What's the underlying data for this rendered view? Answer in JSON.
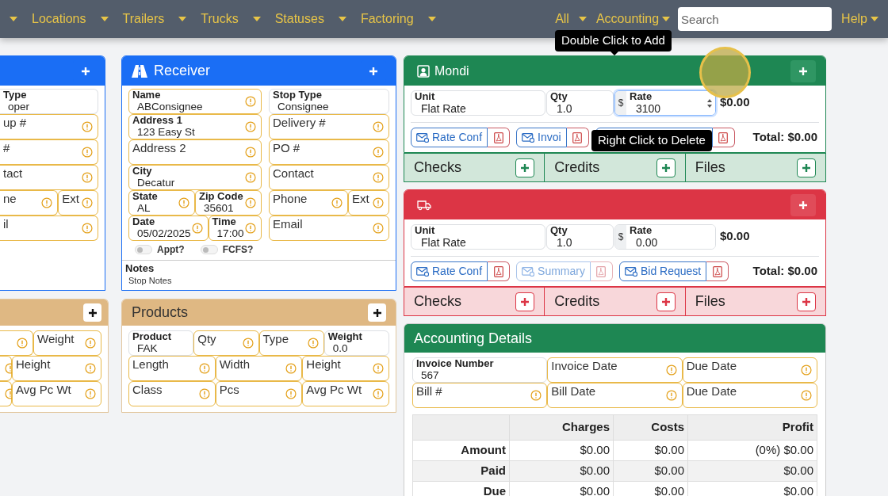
{
  "navbar": {
    "menus": [
      {
        "label": "Locations"
      },
      {
        "label": "Trailers"
      },
      {
        "label": "Trucks"
      },
      {
        "label": "Statuses"
      },
      {
        "label": "Factoring"
      }
    ],
    "right_menus": [
      {
        "label": "All"
      },
      {
        "label": "Accounting"
      }
    ],
    "search": {
      "placeholder": "Search"
    },
    "help": {
      "label": "Help"
    }
  },
  "shipper_partial": {
    "rows": [
      [
        {
          "label": "Type",
          "value": "oper",
          "warning": false
        }
      ],
      [
        {
          "label": "up #",
          "warning": true
        }
      ],
      [
        {
          "label": "#",
          "warning": true
        }
      ],
      [
        {
          "label": "tact",
          "warning": true
        }
      ],
      [
        {
          "label": "ne",
          "warning": true
        },
        {
          "label": "Ext",
          "warning": true
        }
      ],
      [
        {
          "label": "il",
          "warning": true
        }
      ]
    ]
  },
  "receiver": {
    "title": "Receiver",
    "left_rows": [
      [
        {
          "label": "Name",
          "value": "ABConsignee",
          "warning": true
        }
      ],
      [
        {
          "label": "Address 1",
          "value": "123 Easy St",
          "warning": true
        }
      ],
      [
        {
          "label": "Address 2",
          "warning": true
        }
      ],
      [
        {
          "label": "City",
          "value": "Decatur",
          "warning": true
        }
      ],
      [
        {
          "label": "State",
          "value": "AL",
          "warning": true
        },
        {
          "label": "Zip Code",
          "value": "35601",
          "warning": true
        }
      ],
      [
        {
          "label": "Date",
          "value": "05/02/2025",
          "warning": true
        },
        {
          "label": "Time",
          "value": "17:00",
          "warning": true
        }
      ]
    ],
    "right_rows": [
      [
        {
          "label": "Stop Type",
          "value": "Consignee",
          "warning": false
        }
      ],
      [
        {
          "label": "Delivery #",
          "warning": true
        }
      ],
      [
        {
          "label": "PO #",
          "warning": true
        }
      ],
      [
        {
          "label": "Contact",
          "warning": true
        }
      ],
      [
        {
          "label": "Phone",
          "warning": true
        },
        {
          "label": "Ext",
          "warning": true
        }
      ],
      [
        {
          "label": "Email",
          "warning": true
        }
      ]
    ],
    "toggles": [
      {
        "label": "Appt?",
        "on": false
      },
      {
        "label": "FCFS?",
        "on": false
      }
    ],
    "notes": {
      "label": "Notes",
      "value": "Stop Notes"
    }
  },
  "products_partial": {
    "rows": [
      [
        {
          "warning": true
        },
        {
          "label": "Weight",
          "warning": true
        }
      ],
      [
        {
          "warning": true
        },
        {
          "label": "Height",
          "warning": true
        }
      ],
      [
        {
          "warning": true
        },
        {
          "label": "Avg Pc Wt",
          "warning": true
        }
      ]
    ]
  },
  "products": {
    "title": "Products",
    "rows": [
      [
        {
          "label": "Product",
          "value": "FAK",
          "warning": false
        },
        {
          "label": "Qty",
          "warning": true
        },
        {
          "label": "Type",
          "warning": true
        },
        {
          "label": "Weight",
          "value": "0.0",
          "warning": false
        }
      ],
      [
        {
          "label": "Length",
          "warning": true
        },
        {
          "label": "Width",
          "warning": true
        },
        {
          "label": "Height",
          "warning": true
        }
      ],
      [
        {
          "label": "Class",
          "warning": true
        },
        {
          "label": "Pcs",
          "warning": true
        },
        {
          "label": "Avg Pc Wt",
          "warning": true
        }
      ]
    ]
  },
  "carriers": [
    {
      "kind": "carrier",
      "title": "Mondi",
      "unit": {
        "label": "Unit",
        "value": "Flat Rate"
      },
      "qty": {
        "label": "Qty",
        "value": "1.0"
      },
      "currency": "$",
      "rate": {
        "label": "Rate",
        "value": "3100",
        "focused": true
      },
      "amount": "$0.00",
      "documents": [
        {
          "label": "Rate Conf",
          "disabled": false
        },
        {
          "label": "Invoi",
          "disabled": false
        },
        {
          "disabled": false
        }
      ],
      "total": "Total: $0.00",
      "sections": [
        {
          "label": "Checks"
        },
        {
          "label": "Credits"
        },
        {
          "label": "Files"
        }
      ]
    },
    {
      "kind": "truck",
      "unit": {
        "label": "Unit",
        "value": "Flat Rate"
      },
      "qty": {
        "label": "Qty",
        "value": "1.0"
      },
      "currency": "$",
      "rate": {
        "label": "Rate",
        "value": "0.00",
        "focused": false
      },
      "amount": "$0.00",
      "documents": [
        {
          "label": "Rate Conf",
          "disabled": false
        },
        {
          "label": "Summary",
          "disabled": true
        },
        {
          "label": "Bid Request",
          "disabled": false
        }
      ],
      "total": "Total: $0.00",
      "sections": [
        {
          "label": "Checks"
        },
        {
          "label": "Credits"
        },
        {
          "label": "Files"
        }
      ]
    }
  ],
  "accounting": {
    "title": "Accounting Details",
    "rows": [
      [
        {
          "label": "Invoice Number",
          "value": "567",
          "warning": false
        },
        {
          "label": "Invoice Date",
          "warning": true
        },
        {
          "label": "Due Date",
          "warning": true
        }
      ],
      [
        {
          "label": "Bill #",
          "warning": true
        },
        {
          "label": "Bill Date",
          "warning": true
        },
        {
          "label": "Due Date",
          "warning": true
        }
      ]
    ],
    "table": {
      "columns": [
        "Charges",
        "Costs",
        "Profit"
      ],
      "rows": [
        {
          "label": "Amount",
          "cells": [
            "$0.00",
            "$0.00",
            "(0%) $0.00"
          ]
        },
        {
          "label": "Paid",
          "cells": [
            "$0.00",
            "$0.00",
            "$0.00"
          ]
        },
        {
          "label": "Due",
          "cells": [
            "$0.00",
            "$0.00",
            "$0.00"
          ]
        }
      ]
    }
  },
  "tooltips": [
    {
      "text": "Double Click to Add"
    },
    {
      "text": "Right Click to Delete"
    }
  ]
}
